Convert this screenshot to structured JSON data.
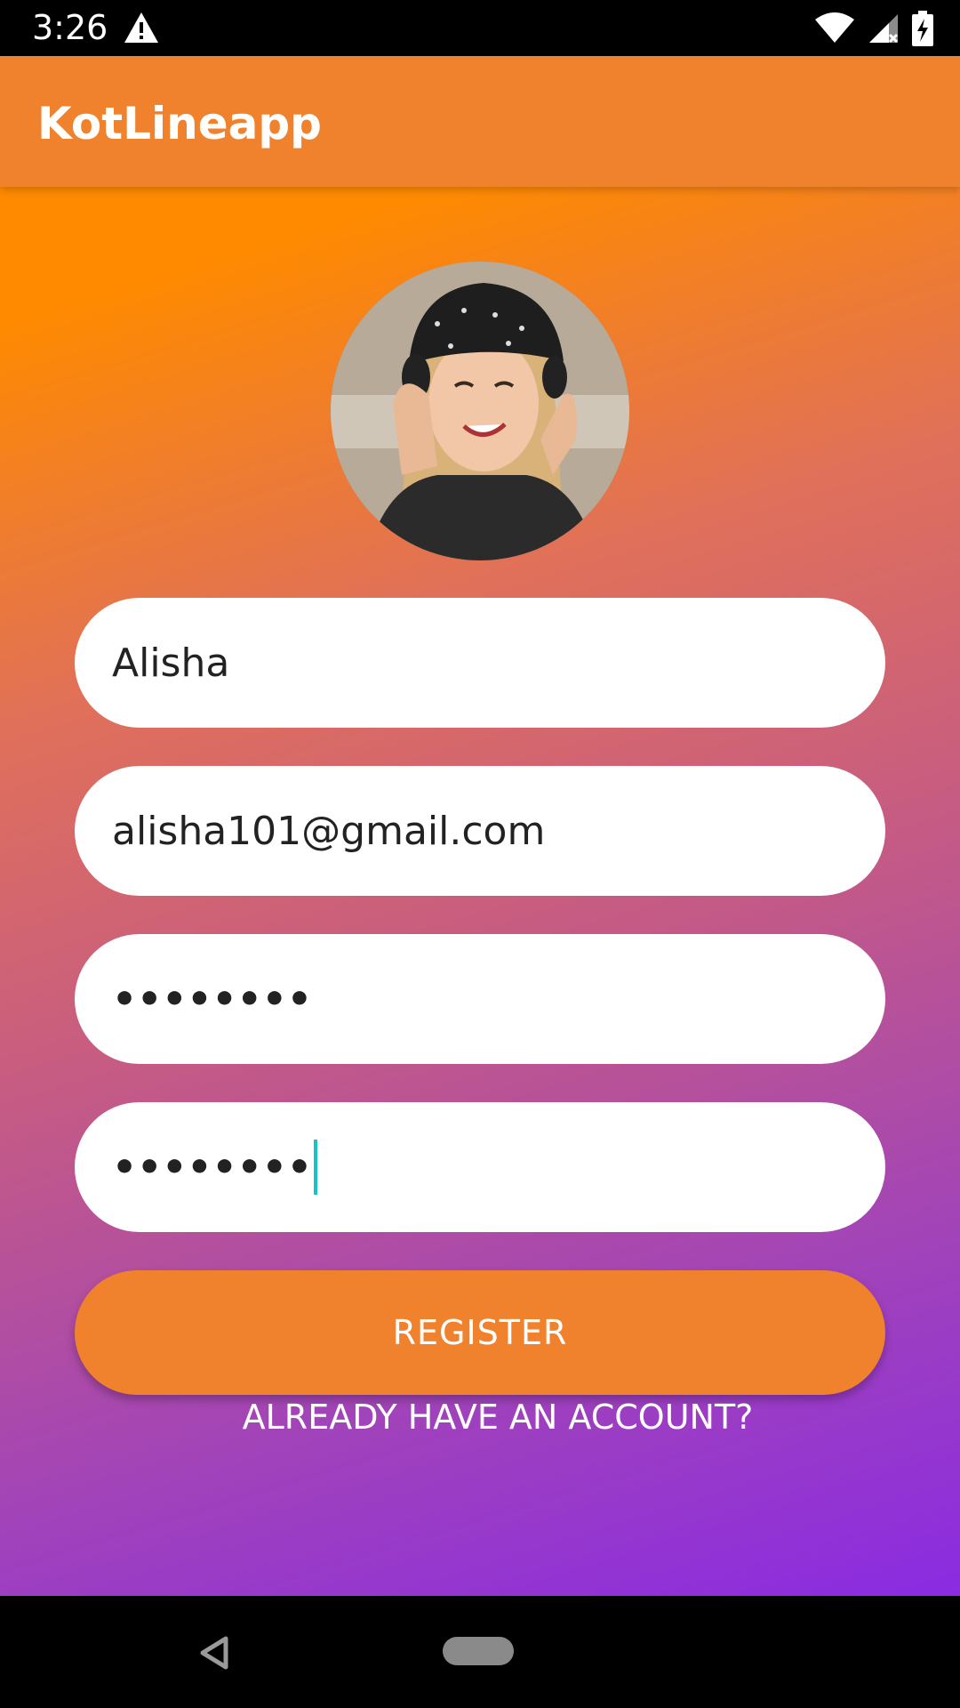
{
  "status_bar": {
    "time": "3:26"
  },
  "app_bar": {
    "title": "KotLineapp"
  },
  "form": {
    "name_value": "Alisha",
    "email_value": "alisha101@gmail.com",
    "password_value": "••••••••",
    "confirm_password_value": "••••••••",
    "register_label": "REGISTER",
    "login_link_label": "ALREADY HAVE AN ACCOUNT?"
  },
  "colors": {
    "accent": "#f0822d",
    "gradient_top": "#ff8a00",
    "gradient_bottom": "#8a2be2",
    "cursor": "#19c4c4"
  },
  "icons": {
    "status_warning": "warning-icon",
    "status_wifi": "wifi-icon",
    "status_signal": "signal-no-data-icon",
    "status_battery": "battery-charging-icon",
    "nav_back": "back-icon",
    "nav_home": "home-pill-icon"
  }
}
